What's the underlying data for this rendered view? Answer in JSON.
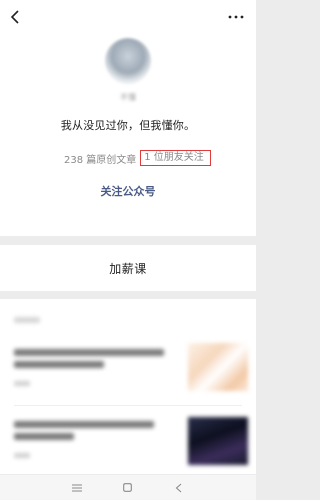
{
  "profile": {
    "nickname": "不懂",
    "signature": "我从没见过你，但我懂你。",
    "articles_count_text": "238 篇原创文章",
    "friends_following_text": "1 位朋友关注",
    "follow_button_label": "关注公众号",
    "highlight_color": "#e23b3b",
    "link_color": "#4a5c86"
  },
  "menu": {
    "items": [
      "加薪课"
    ]
  },
  "icons": {
    "back": "chevron-left-icon",
    "more": "more-dots-icon",
    "nav_menu": "menu-lines-icon",
    "nav_home": "square-home-icon",
    "nav_back": "chevron-left-icon"
  }
}
